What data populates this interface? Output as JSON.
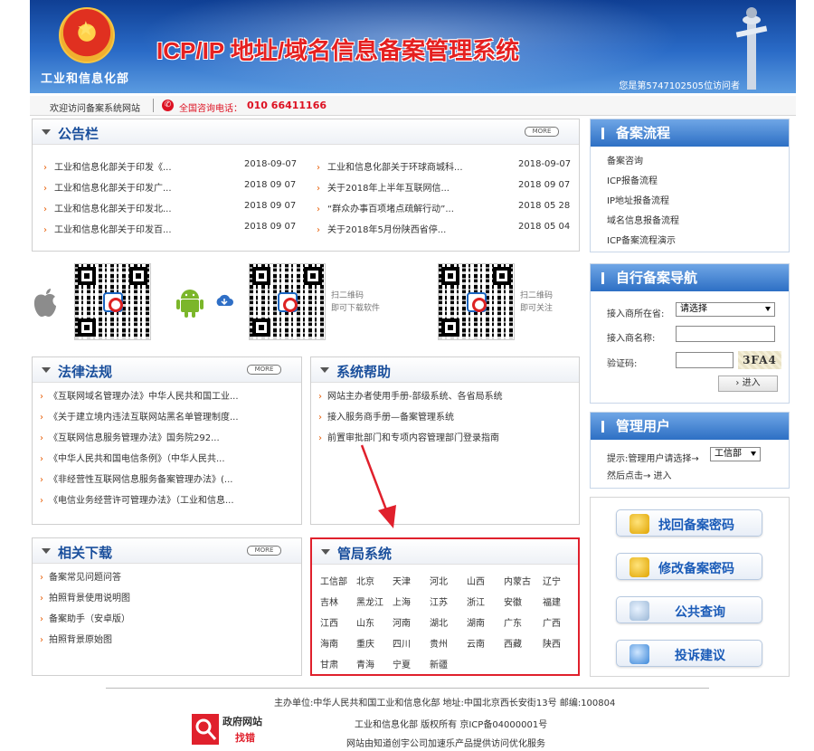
{
  "header": {
    "title": "ICP/IP 地址/域名信息备案管理系统",
    "ministry": "工业和信息化部",
    "visitor_text": "您是第5747102505位访问者"
  },
  "welcome": {
    "text": "欢迎访问备案系统网站",
    "phone_label": "全国咨询电话：",
    "phone_number": "010 66411166"
  },
  "announcements": {
    "title": "公告栏",
    "more": "MORE",
    "left": [
      {
        "title": "工业和信息化部关于印发《...",
        "date": "2018-09-07"
      },
      {
        "title": "工业和信息化部关于印发广...",
        "date": "2018 09 07"
      },
      {
        "title": "工业和信息化部关于印发北...",
        "date": "2018 09 07"
      },
      {
        "title": "工业和信息化部关于印发百...",
        "date": "2018 09 07"
      }
    ],
    "right": [
      {
        "title": "工业和信息化部关于环球商城科...",
        "date": "2018-09-07"
      },
      {
        "title": "关于2018年上半年互联网信...",
        "date": "2018 09 07"
      },
      {
        "title": "“群众办事百项堵点疏解行动”...",
        "date": "2018 05 28"
      },
      {
        "title": "关于2018年5月份陕西省停...",
        "date": "2018 05 04"
      }
    ]
  },
  "qr": {
    "caption1_line1": "扫二维码",
    "caption1_line2": "即可下载软件",
    "caption2_line1": "扫二维码",
    "caption2_line2": "即可关注"
  },
  "laws": {
    "title": "法律法规",
    "more": "MORE",
    "items": [
      "《互联网域名管理办法》中华人民共和国工业...",
      "《关于建立境内违法互联网站黑名单管理制度...",
      "《互联网信息服务管理办法》国务院292...",
      "《中华人民共和国电信条例》（中华人民共...",
      "《非经营性互联网信息服务备案管理办法》(...",
      "《电信业务经营许可管理办法》（工业和信息..."
    ]
  },
  "help": {
    "title": "系统帮助",
    "items": [
      "网站主办者使用手册-部级系统、各省局系统",
      "接入服务商手册—备案管理系统",
      "前置审批部门和专项内容管理部门登录指南"
    ]
  },
  "downloads": {
    "title": "相关下载",
    "more": "MORE",
    "items": [
      "备案常见问题问答",
      "拍照背景使用说明图",
      "备案助手（安卓版）",
      "拍照背景原始图"
    ]
  },
  "provinces": {
    "title": "管局系统",
    "rows": [
      [
        "工信部",
        "北京",
        "天津",
        "河北",
        "山西",
        "内蒙古",
        "辽宁"
      ],
      [
        "吉林",
        "黑龙江",
        "上海",
        "江苏",
        "浙江",
        "安徽",
        "福建"
      ],
      [
        "江西",
        "山东",
        "河南",
        "湖北",
        "湖南",
        "广东",
        "广西"
      ],
      [
        "海南",
        "重庆",
        "四川",
        "贵州",
        "云南",
        "西藏",
        "陕西"
      ],
      [
        "甘肃",
        "青海",
        "宁夏",
        "新疆"
      ]
    ]
  },
  "process": {
    "title": "备案流程",
    "items": [
      "备案咨询",
      "ICP报备流程",
      "IP地址报备流程",
      "域名信息报备流程",
      "ICP备案流程演示"
    ]
  },
  "nav": {
    "title": "自行备案导航",
    "province_label": "接入商所在省:",
    "province_value": "请选择",
    "name_label": "接入商名称:",
    "captcha_label": "验证码:",
    "captcha_text": "3FA4",
    "enter": "进入"
  },
  "admin": {
    "title": "管理用户",
    "line1_prefix": "提示:管理用户请选择→",
    "dept_value": "工信部",
    "line2": "然后点击→ 进入"
  },
  "buttons": {
    "retrieve": "找回备案密码",
    "modify": "修改备案密码",
    "query": "公共查询",
    "complaint": "投诉建议"
  },
  "footer": {
    "sponsor": "主办单位:中华人民共和国工业和信息化部 地址:中国北京西长安街13号 邮编:100804",
    "copyright": "工业和信息化部 版权所有 京ICP备04000001号",
    "cdn": "网站由知道创宇公司加速乐产品提供访问优化服务",
    "gov_badge_top": "政府网站",
    "gov_badge_bottom": "找错"
  },
  "colors": {
    "header_blue": "#2a6bc7",
    "title_red": "#e52020",
    "accent_orange": "#e85a00",
    "highlight_red": "#e0202c"
  }
}
